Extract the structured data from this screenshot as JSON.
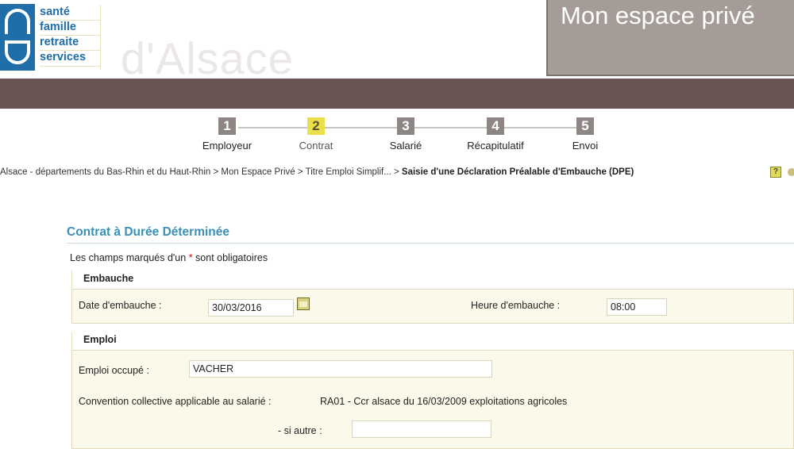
{
  "header": {
    "logo_lines": [
      "santé",
      "famille",
      "retraite",
      "services"
    ],
    "region": "d'Alsace",
    "espace_title": "Mon espace privé"
  },
  "steps": [
    {
      "num": "1",
      "label": "Employeur",
      "active": false
    },
    {
      "num": "2",
      "label": "Contrat",
      "active": true
    },
    {
      "num": "3",
      "label": "Salarié",
      "active": false
    },
    {
      "num": "4",
      "label": "Récapitulatif",
      "active": false
    },
    {
      "num": "5",
      "label": "Envoi",
      "active": false
    }
  ],
  "breadcrumb": {
    "trail": "Alsace - départements du Bas-Rhin et du Haut-Rhin > Mon Espace Privé > Titre Emploi Simplif... > ",
    "current": "Saisie d'une Déclaration Préalable d'Embauche (DPE)"
  },
  "icons": {
    "help": "help-icon",
    "calendar": "calendar-icon"
  },
  "colors": {
    "accent_blue": "#3a8fb7",
    "brand_blue": "#1f6ea8",
    "band_brown": "#6a5452",
    "active_step": "#e9e04b"
  },
  "form": {
    "title": "Contrat à Durée Déterminée",
    "required_note_prefix": "Les champs marqués d'un ",
    "required_star": "*",
    "required_note_suffix": " sont obligatoires",
    "embauche": {
      "heading": "Embauche",
      "date_label": "Date d'embauche :",
      "date_value": "30/03/2016",
      "heure_label": "Heure d'embauche :",
      "heure_value": "08:00"
    },
    "emploi": {
      "heading": "Emploi",
      "emploi_label": "Emploi occupé :",
      "emploi_value": "VACHER",
      "convention_label": "Convention collective applicable au salarié :",
      "convention_value": "RA01 - Ccr alsace du 16/03/2009 exploitations agricoles",
      "autre_label": "- si autre :",
      "autre_value": ""
    }
  }
}
